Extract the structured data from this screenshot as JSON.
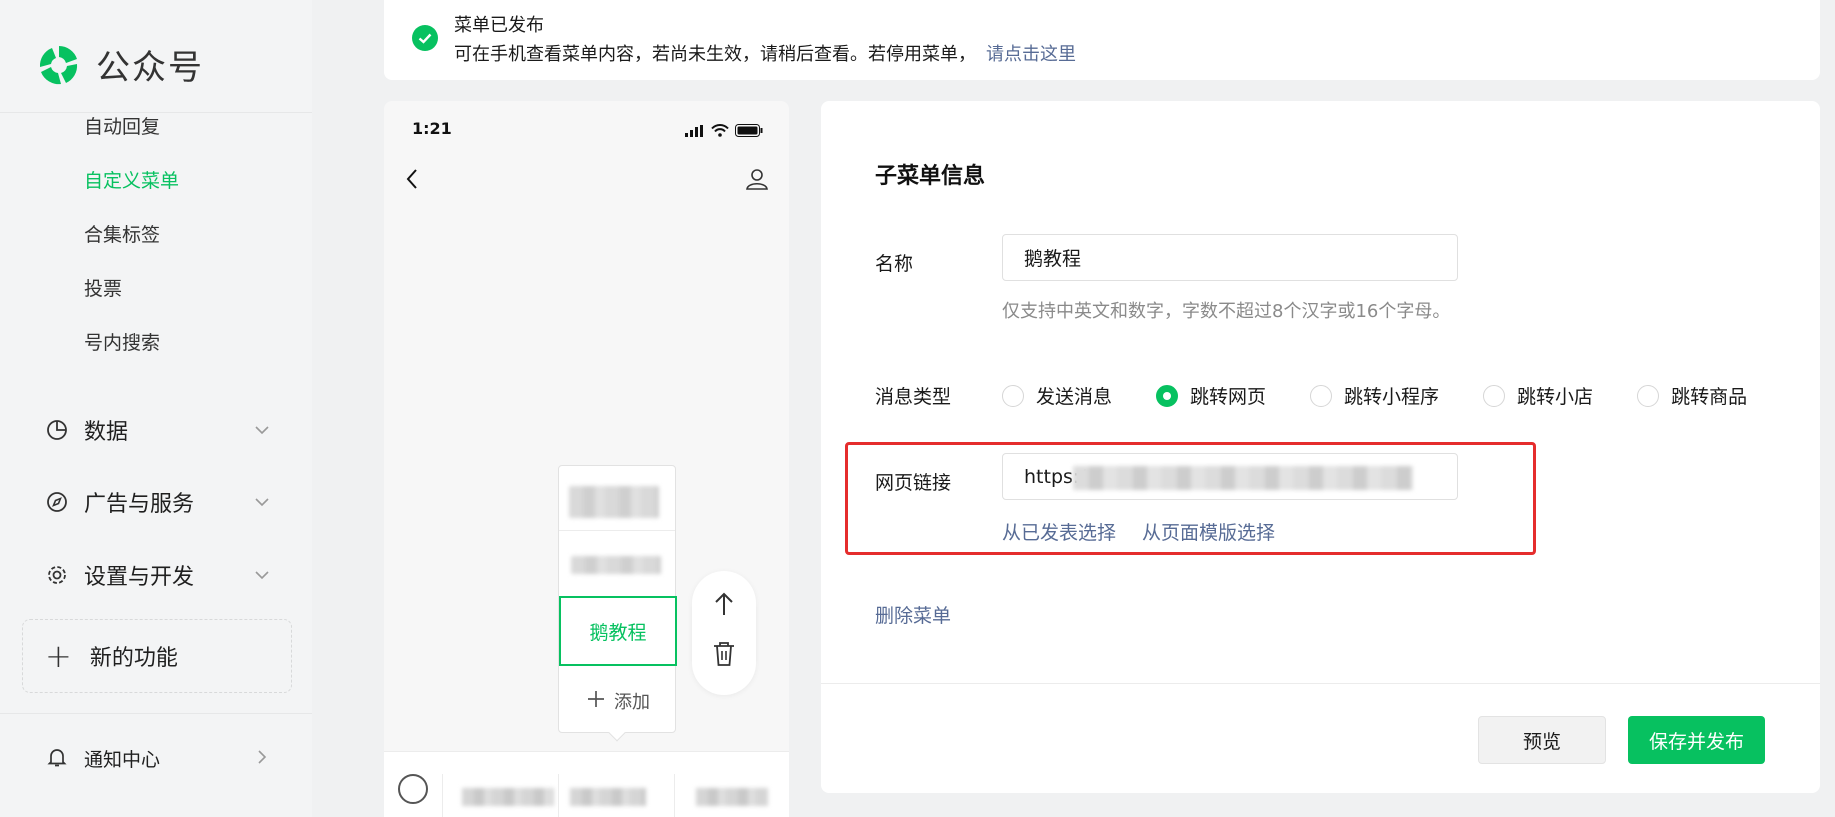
{
  "brand": {
    "name": "公众号",
    "accent": "#07c160",
    "link_color": "#576b95"
  },
  "sidebar": {
    "sub_items": [
      {
        "label": "自动回复",
        "active": false
      },
      {
        "label": "自定义菜单",
        "active": true
      },
      {
        "label": "合集标签",
        "active": false
      },
      {
        "label": "投票",
        "active": false
      },
      {
        "label": "号内搜索",
        "active": false
      }
    ],
    "groups": [
      {
        "label": "数据",
        "icon": "pie-chart-icon"
      },
      {
        "label": "广告与服务",
        "icon": "compass-icon"
      },
      {
        "label": "设置与开发",
        "icon": "gear-icon"
      }
    ],
    "new_feature": "新的功能",
    "notify": "通知中心"
  },
  "notice": {
    "title": "菜单已发布",
    "text": "可在手机查看菜单内容，若尚未生效，请稍后查看。若停用菜单，",
    "link": "请点击这里"
  },
  "phone": {
    "time": "1:21",
    "selected_item": "鹅教程",
    "add_label": "添加"
  },
  "form": {
    "section_title": "子菜单信息",
    "name_label": "名称",
    "name_value": "鹅教程",
    "name_hint": "仅支持中英文和数字，字数不超过8个汉字或16个字母。",
    "msg_type_label": "消息类型",
    "msg_types": [
      {
        "label": "发送消息",
        "selected": false
      },
      {
        "label": "跳转网页",
        "selected": true
      },
      {
        "label": "跳转小程序",
        "selected": false
      },
      {
        "label": "跳转小店",
        "selected": false
      },
      {
        "label": "跳转商品",
        "selected": false
      }
    ],
    "url_label": "网页链接",
    "url_prefix": "https:/",
    "link_published": "从已发表选择",
    "link_template": "从页面模版选择",
    "delete_label": "删除菜单",
    "preview_label": "预览",
    "save_label": "保存并发布"
  }
}
